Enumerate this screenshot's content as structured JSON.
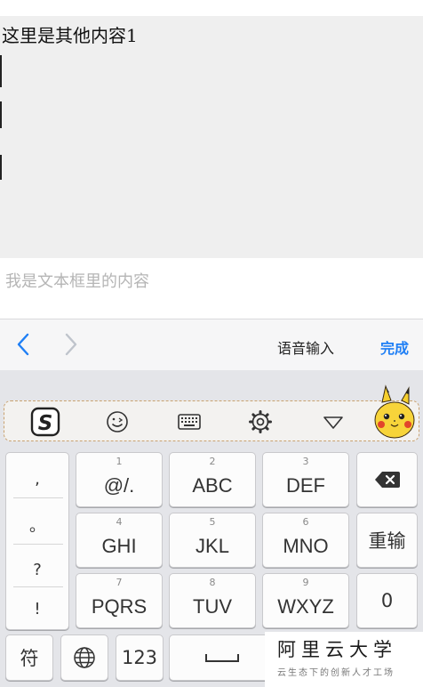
{
  "content": {
    "text": "这里是其他内容1"
  },
  "text_field": {
    "value": "我是文本框里的内容"
  },
  "accessory_bar": {
    "prev_icon": "chevron-left-icon",
    "next_icon": "chevron-right-icon",
    "voice_input_label": "语音输入",
    "done_label": "完成",
    "accent_color": "#1f7ff5"
  },
  "ime_toolbar": {
    "items": [
      {
        "icon": "sogou-logo-icon"
      },
      {
        "icon": "emoji-icon"
      },
      {
        "icon": "keyboard-icon"
      },
      {
        "icon": "gear-icon"
      },
      {
        "icon": "collapse-triangle-icon"
      }
    ],
    "mascot_icon": "pikachu-icon"
  },
  "keyboard": {
    "punctuation": [
      ",",
      "。",
      "?",
      "!"
    ],
    "keys": [
      {
        "num": "1",
        "label": "@/."
      },
      {
        "num": "2",
        "label": "ABC"
      },
      {
        "num": "3",
        "label": "DEF"
      },
      {
        "num": "4",
        "label": "GHI"
      },
      {
        "num": "5",
        "label": "JKL"
      },
      {
        "num": "6",
        "label": "MNO"
      },
      {
        "num": "7",
        "label": "PQRS"
      },
      {
        "num": "8",
        "label": "TUV"
      },
      {
        "num": "9",
        "label": "WXYZ"
      }
    ],
    "backspace_icon": "backspace-icon",
    "reenter_label": "重输",
    "zero_label": "0",
    "symbol_label": "符",
    "globe_icon": "globe-icon",
    "numeric_label": "123",
    "space_icon": "space-bar-icon"
  },
  "watermark": {
    "title": "阿里云大学",
    "subtitle": "云生态下的创新人才工场"
  }
}
